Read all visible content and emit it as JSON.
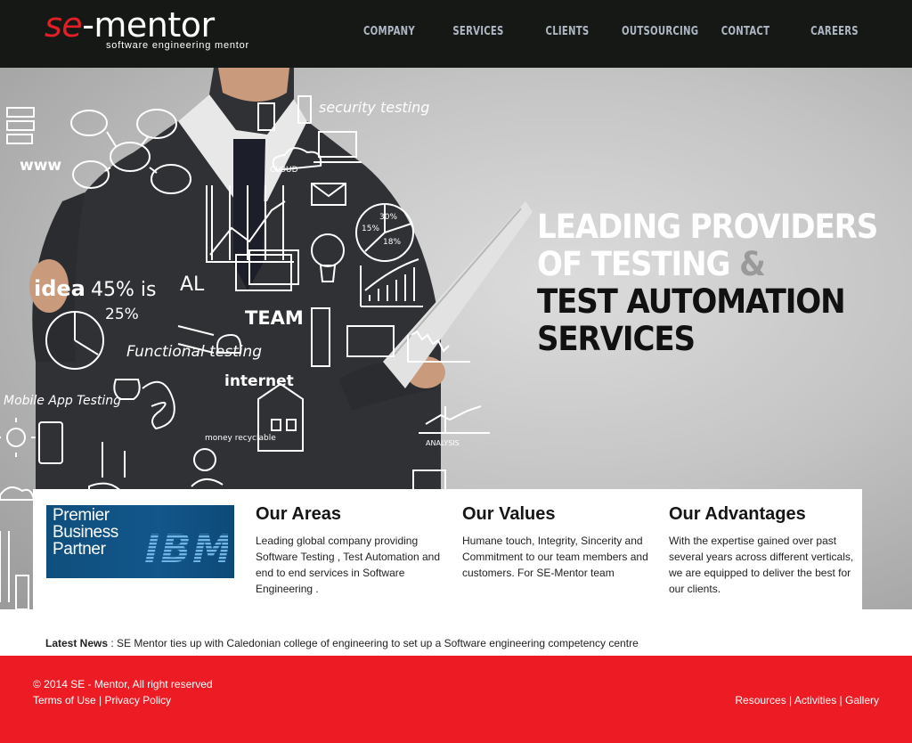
{
  "header": {
    "logo": {
      "brand_prefix": "se",
      "brand_rest": "-mentor",
      "tagline": "software engineering mentor"
    },
    "nav": [
      "COMPANY",
      "SERVICES",
      "CLIENTS",
      "OUTSOURCING",
      "CONTACT",
      "CAREERS"
    ]
  },
  "hero": {
    "headline": {
      "line1": "LEADING PROVIDERS",
      "line2": "OF TESTING",
      "line2_amp": "&",
      "line3": "TEST AUTOMATION",
      "line4": "SERVICES"
    },
    "doodles": [
      "security testing",
      "www",
      "CLOUD",
      "idea",
      "45% is",
      "AL",
      "25%",
      "TEAM",
      "Functional testing",
      "internet",
      "Mobile App Testing",
      "30%",
      "15%",
      "18%",
      "money recyclable",
      "ANALYSIS"
    ]
  },
  "partner": {
    "line1": "Premier",
    "line2": "Business",
    "line3": "Partner",
    "logo": "IBM"
  },
  "sections": [
    {
      "title": "Our Areas",
      "text": "Leading global company providing Software Testing , Test Automation and end to end services in Software Engineering ."
    },
    {
      "title": "Our Values",
      "text": "Humane touch, Integrity, Sincerity and Commitment to our team members and customers. For SE-Mentor team"
    },
    {
      "title": "Our Advantages",
      "text": "With the expertise gained over past several years across different verticals, we are equipped to deliver the best for our clients."
    }
  ],
  "news": {
    "label": "Latest News",
    "separator": " : ",
    "text": "SE Mentor ties up with Caledonian college of engineering to set up a Software engineering competency centre"
  },
  "footer": {
    "copyright": "© 2014 SE - Mentor, All right reserved",
    "terms": "Terms of Use",
    "privacy": "Privacy Policy",
    "sep": " | ",
    "resources": "Resources",
    "activities": "Activities",
    "gallery": "Gallery"
  },
  "colors": {
    "brand_red": "#e21f26",
    "footer_red": "#ed1c24",
    "header_bg": "#151815",
    "nav_text": "#aeb8c4",
    "ibm_blue": "#0f4f7d"
  }
}
